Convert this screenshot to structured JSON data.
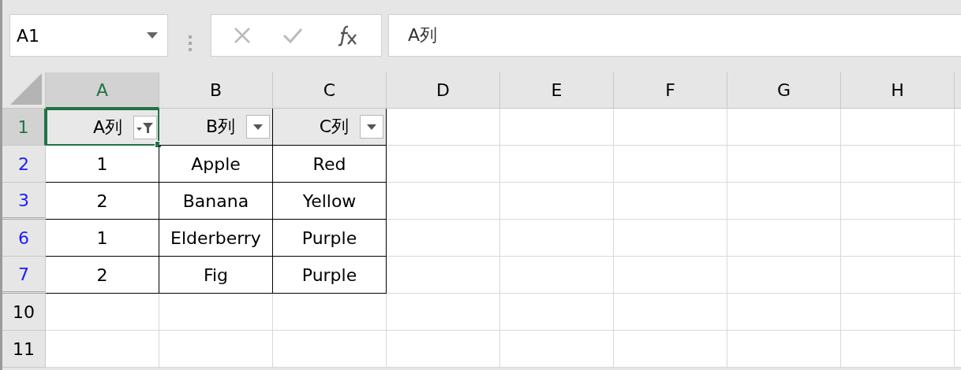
{
  "name_box": {
    "value": "A1"
  },
  "formula_bar": {
    "value": "A列"
  },
  "columns": [
    {
      "label": "A",
      "selected": true
    },
    {
      "label": "B",
      "selected": false
    },
    {
      "label": "C",
      "selected": false
    },
    {
      "label": "D",
      "selected": false
    },
    {
      "label": "E",
      "selected": false
    },
    {
      "label": "F",
      "selected": false
    },
    {
      "label": "G",
      "selected": false
    },
    {
      "label": "H",
      "selected": false
    }
  ],
  "rows": [
    {
      "number": "1",
      "selected": true,
      "filtered": false,
      "hidden_below": false,
      "cells": [
        {
          "kind": "header",
          "text": "A列",
          "selected": true,
          "filter_applied": true
        },
        {
          "kind": "header",
          "text": "B列",
          "selected": false,
          "filter_applied": false
        },
        {
          "kind": "header",
          "text": "C列",
          "selected": false,
          "filter_applied": false
        }
      ]
    },
    {
      "number": "2",
      "selected": false,
      "filtered": true,
      "hidden_below": false,
      "cells": [
        {
          "kind": "data",
          "text": "1",
          "selected": false
        },
        {
          "kind": "data",
          "text": "Apple",
          "selected": false
        },
        {
          "kind": "data",
          "text": "Red",
          "selected": false
        }
      ]
    },
    {
      "number": "3",
      "selected": false,
      "filtered": true,
      "hidden_below": true,
      "cells": [
        {
          "kind": "data",
          "text": "2",
          "selected": false
        },
        {
          "kind": "data",
          "text": "Banana",
          "selected": false
        },
        {
          "kind": "data",
          "text": "Yellow",
          "selected": false
        }
      ]
    },
    {
      "number": "6",
      "selected": false,
      "filtered": true,
      "hidden_below": false,
      "cells": [
        {
          "kind": "data",
          "text": "1",
          "selected": false
        },
        {
          "kind": "data",
          "text": "Elderberry",
          "selected": false
        },
        {
          "kind": "data",
          "text": "Purple",
          "selected": false
        }
      ]
    },
    {
      "number": "7",
      "selected": false,
      "filtered": true,
      "hidden_below": true,
      "cells": [
        {
          "kind": "data",
          "text": "2",
          "selected": false
        },
        {
          "kind": "data",
          "text": "Fig",
          "selected": false
        },
        {
          "kind": "data",
          "text": "Purple",
          "selected": false
        }
      ]
    },
    {
      "number": "10",
      "selected": false,
      "filtered": false,
      "hidden_below": false,
      "cells": []
    },
    {
      "number": "11",
      "selected": false,
      "filtered": false,
      "hidden_below": false,
      "cells": []
    }
  ]
}
